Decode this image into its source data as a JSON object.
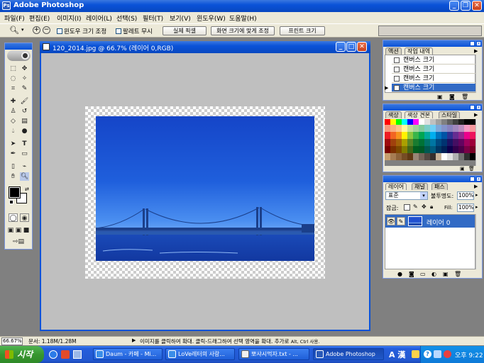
{
  "app": {
    "title": "Adobe Photoshop"
  },
  "menubar": {
    "items": [
      "파일(F)",
      "편집(E)",
      "이미지(I)",
      "레이어(L)",
      "선택(S)",
      "필터(T)",
      "보기(V)",
      "윈도우(W)",
      "도움말(H)"
    ]
  },
  "options_bar": {
    "resize_windows_label": "윈도우 크기 조정",
    "ignore_palettes_label": "팔레트 무시",
    "actual_pixels": "실제 픽셀",
    "fit_on_screen": "화면 크기에 맞게 조정",
    "print_size": "프린트 크기"
  },
  "document": {
    "title": "120_2014.jpg @ 66.7% (레이어 0,RGB)"
  },
  "history_palette": {
    "tabs": [
      "액션",
      "작업 내역"
    ],
    "items": [
      "캔버스 크기",
      "캔버스 크기",
      "캔버스 크기",
      "캔버스 크기"
    ],
    "selected_index": 3
  },
  "swatches_palette": {
    "tabs": [
      "색상",
      "색상 견본",
      "스타일"
    ]
  },
  "layers_palette": {
    "tabs": [
      "레이어",
      "채널",
      "패스"
    ],
    "blend_mode": "표준",
    "opacity_label": "불투명도:",
    "opacity_value": "100%",
    "lock_label": "잠금:",
    "fill_label": "Fill:",
    "fill_value": "100%",
    "layer_name": "레이어 0"
  },
  "status_bar": {
    "zoom": "66.67%",
    "doc_info": "문서: 1.18M/1.28M",
    "message": "이미지를 클릭하여 확대. 클릭-드래그하여 선택 영역을 확대. 추가로",
    "message_keys": "Alt, Ctrl 사용."
  },
  "taskbar": {
    "start_label": "시작",
    "tasks": [
      "Daum - 카페 - Mi...",
      "LoVe레터의 사랑...",
      "뽀샤시먹자.txt - ...",
      "Adobe Photoshop"
    ],
    "active_task_index": 3,
    "ime": "A 漢",
    "clock": "오후 9:22"
  },
  "colors": {
    "xp_blue": "#0a52d8",
    "workspace_gray": "#808080",
    "canvas_bg": "#bfbfbf",
    "sky_blue": "#1f5fdc",
    "selection_blue": "#316ac5"
  }
}
